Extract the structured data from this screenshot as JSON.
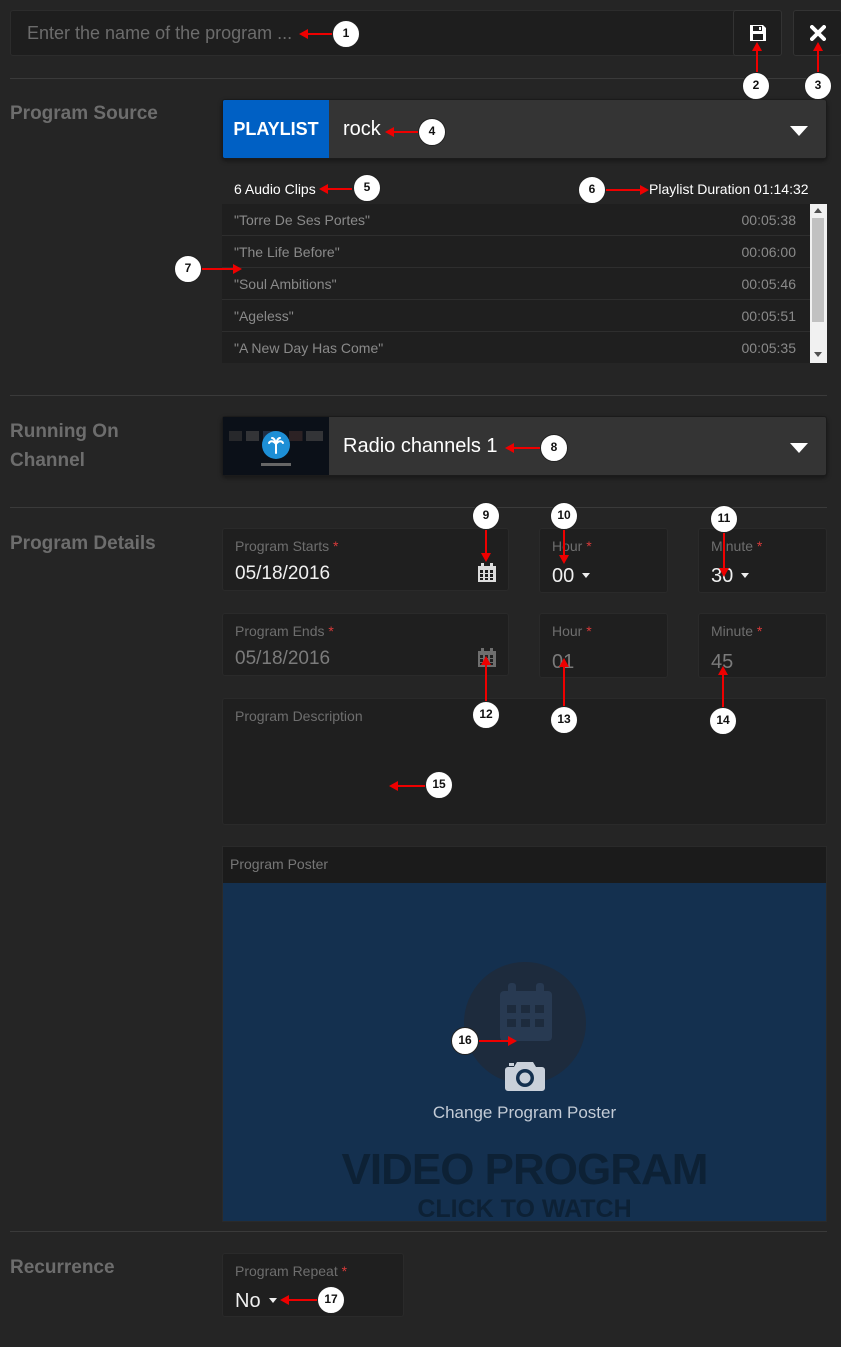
{
  "header": {
    "title_placeholder": "Enter the name of the program ...",
    "save_icon": "floppy-disk-icon",
    "close_icon": "close-icon"
  },
  "program_source": {
    "label": "Program Source",
    "badge": "PLAYLIST",
    "badge_color": "#0060c4",
    "selected": "rock",
    "clip_count": "6 Audio Clips",
    "duration": "Playlist Duration 01:14:32",
    "clips": [
      {
        "title": "\"Torre De Ses Portes\"",
        "duration": "00:05:38"
      },
      {
        "title": "\"The Life Before\"",
        "duration": "00:06:00"
      },
      {
        "title": "\"Soul Ambitions\"",
        "duration": "00:05:46"
      },
      {
        "title": "\"Ageless\"",
        "duration": "00:05:51"
      },
      {
        "title": "\"A New Day Has Come\"",
        "duration": "00:05:35"
      }
    ]
  },
  "running_on_channel": {
    "label": "Running On Channel",
    "selected": "Radio channels 1",
    "thumb_icon": "palm-tree-icon"
  },
  "program_details": {
    "label": "Program Details",
    "starts": {
      "label": "Program Starts",
      "date": "05/18/2016",
      "hour_label": "Hour",
      "hour": "00",
      "minute_label": "Minute",
      "minute": "30"
    },
    "ends": {
      "label": "Program Ends",
      "date": "05/18/2016",
      "hour_label": "Hour",
      "hour": "01",
      "minute_label": "Minute",
      "minute": "45"
    },
    "required_mark": "*",
    "description_label": "Program Description",
    "description_value": "",
    "poster": {
      "label": "Program Poster",
      "change_label": "Change Program Poster",
      "watermark_line1": "VIDEO PROGRAM",
      "watermark_line2": "CLICK TO WATCH",
      "bg_color": "#14304f"
    }
  },
  "recurrence": {
    "label": "Recurrence",
    "repeat_label": "Program Repeat",
    "repeat_value": "No"
  },
  "callouts": [
    "1",
    "2",
    "3",
    "4",
    "5",
    "6",
    "7",
    "8",
    "9",
    "10",
    "11",
    "12",
    "13",
    "14",
    "15",
    "16",
    "17"
  ]
}
